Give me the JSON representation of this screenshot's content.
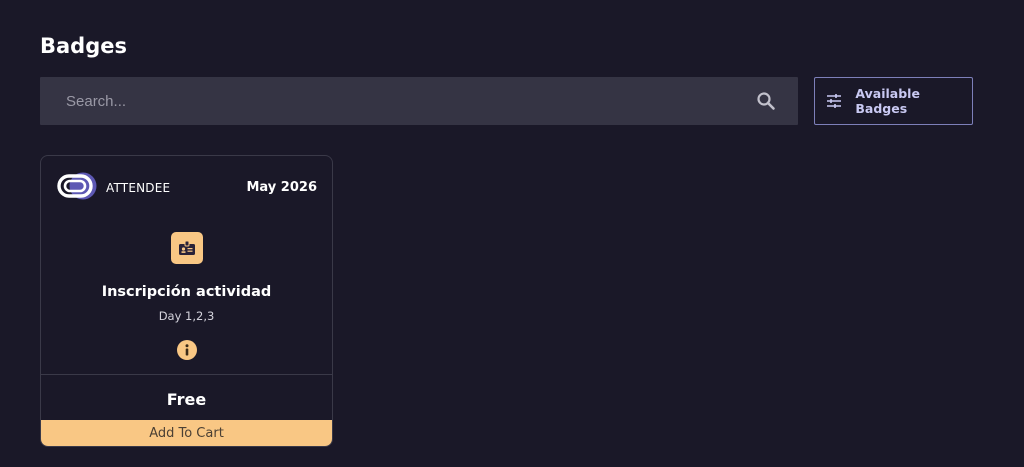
{
  "page": {
    "title": "Badges"
  },
  "search": {
    "placeholder": "Search...",
    "value": "",
    "icon": "search-icon"
  },
  "filter": {
    "label": "Available Badges",
    "icon": "sliders-icon"
  },
  "badges": [
    {
      "type": "ATTENDEE",
      "date": "May 2026",
      "icon": "id-badge-icon",
      "name": "Inscripción actividad",
      "days": "Day 1,2,3",
      "info_icon": "info-icon",
      "price": "Free",
      "action_label": "Add To Cart"
    }
  ],
  "colors": {
    "background": "#1a1828",
    "search_bg": "#353444",
    "accent": "#f9c784",
    "filter_border": "#7d7fb9",
    "filter_text": "#c9c9f2"
  }
}
